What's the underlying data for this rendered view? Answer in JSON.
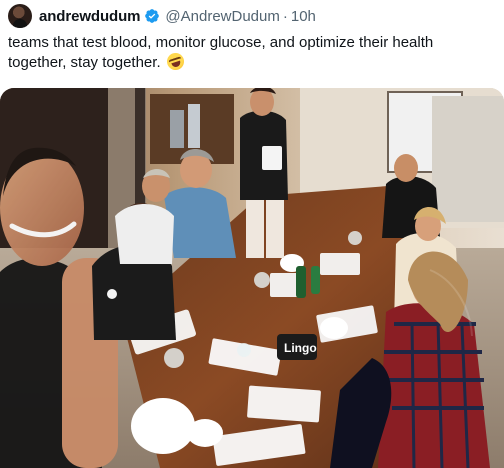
{
  "tweet": {
    "display_name": "andrewdudum",
    "handle": "@AndrewDudum",
    "separator": "·",
    "time": "10h",
    "text": "teams that test blood, monitor glucose, and optimize their health together, stay together.",
    "emoji_icon": "rolling-on-floor-laughing-emoji",
    "verified_icon": "verified-badge-icon",
    "verified_color": "#1d9bf0"
  },
  "photo": {
    "visible_text": {
      "card_label": "Lingo"
    }
  }
}
